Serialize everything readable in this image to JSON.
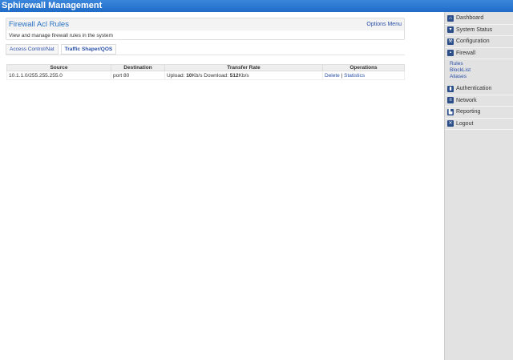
{
  "app_title": "Sphirewall Management",
  "panel": {
    "title": "Firewall Acl Rules",
    "options": "Options Menu",
    "description": "View and manage firewall rules in the system"
  },
  "tabs": [
    {
      "label": "Access Control/Nat"
    },
    {
      "label": "Traffic Shaper/QOS"
    }
  ],
  "table": {
    "headers": [
      "Source",
      "Destination",
      "Transfer Rate",
      "Operations"
    ],
    "rows": [
      {
        "source": "10.1.1.0/255.255.255.0",
        "destination": "port 80",
        "upload_label": "Upload: ",
        "upload": "10",
        "upload_unit": "Kb/s Download: ",
        "download": "512",
        "download_unit": "Kb/s",
        "delete": "Delete",
        "sep": " | ",
        "statistics": "Statistics"
      }
    ]
  },
  "sidebar": {
    "items": [
      {
        "label": "Dashboard",
        "icon": "home-icon"
      },
      {
        "label": "System Status",
        "icon": "status-icon"
      },
      {
        "label": "Configuration",
        "icon": "wrench-icon"
      },
      {
        "label": "Firewall",
        "icon": "firewall-icon"
      },
      {
        "label": "Authentication",
        "icon": "auth-icon"
      },
      {
        "label": "Network",
        "icon": "network-icon"
      },
      {
        "label": "Reporting",
        "icon": "chart-icon"
      },
      {
        "label": "Logout",
        "icon": "close-icon"
      }
    ],
    "firewall_sub": [
      "Rules",
      "BlockList",
      "Aliases"
    ]
  }
}
